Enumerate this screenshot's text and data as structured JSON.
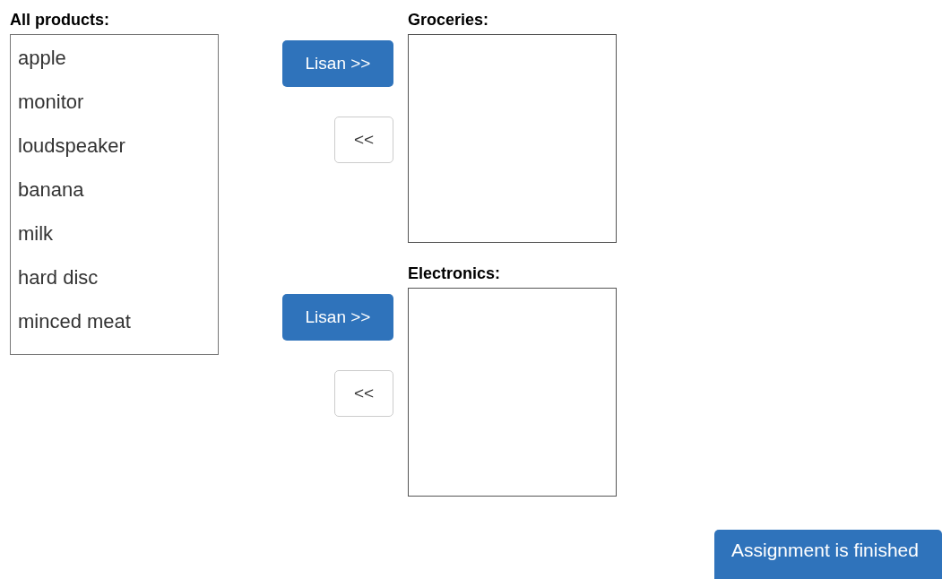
{
  "all_products": {
    "label": "All products:",
    "items": [
      "apple",
      "monitor",
      "loudspeaker",
      "banana",
      "milk",
      "hard disc",
      "minced meat"
    ]
  },
  "categories": [
    {
      "label": "Groceries:",
      "add_button": "Lisan >>",
      "remove_button": "<<"
    },
    {
      "label": "Electronics:",
      "add_button": "Lisan >>",
      "remove_button": "<<"
    }
  ],
  "finish_button": "Assignment is finished"
}
